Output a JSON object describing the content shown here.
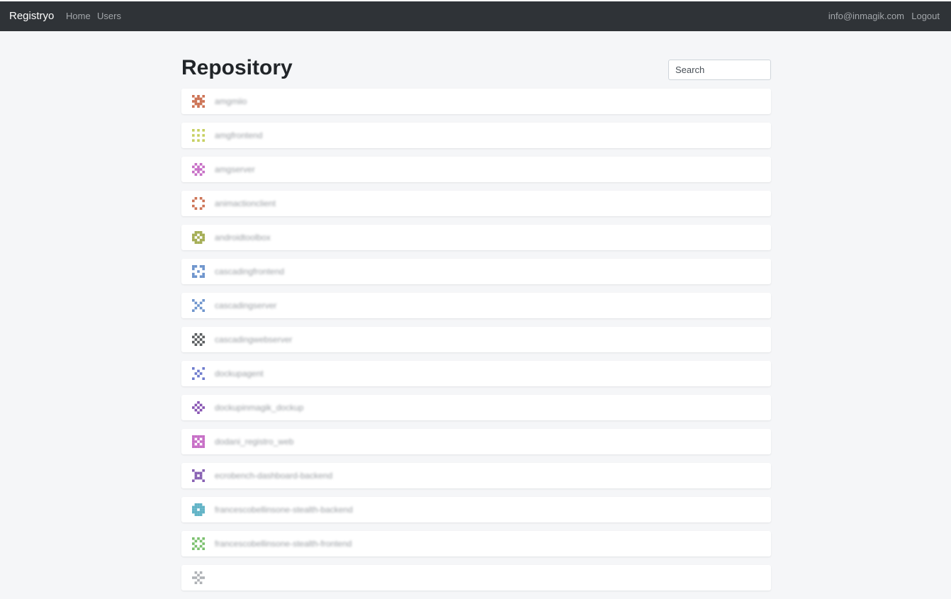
{
  "navbar": {
    "brand": "Registryo",
    "home": "Home",
    "users": "Users",
    "email": "info@inmagik.com",
    "logout": "Logout"
  },
  "page": {
    "title": "Repository",
    "search_placeholder": "Search"
  },
  "repositories": [
    {
      "name": "amgmiio",
      "icon": "identicon",
      "color": "#c0502a"
    },
    {
      "name": "amgfrontend",
      "icon": "identicon",
      "color": "#b8c43a"
    },
    {
      "name": "amgserver",
      "icon": "identicon",
      "color": "#b94bb8"
    },
    {
      "name": "animactionclient",
      "icon": "identicon",
      "color": "#c0502a"
    },
    {
      "name": "androidtoolbox",
      "icon": "identicon",
      "color": "#8f9a2a"
    },
    {
      "name": "cascadingfrontend",
      "icon": "identicon",
      "color": "#4a7ac0"
    },
    {
      "name": "cascadingserver",
      "icon": "identicon",
      "color": "#4a7ac0"
    },
    {
      "name": "cascadingwebserver",
      "icon": "identicon",
      "color": "#2f3337"
    },
    {
      "name": "dockupagent",
      "icon": "identicon",
      "color": "#4a5ac0"
    },
    {
      "name": "dockupinmagik_dockup",
      "icon": "identicon",
      "color": "#6a2aa0"
    },
    {
      "name": "dodani_registro_web",
      "icon": "identicon",
      "color": "#b94bb8"
    },
    {
      "name": "ecrobench-dashboard-backend",
      "icon": "identicon",
      "color": "#6a3aa0"
    },
    {
      "name": "francescobellinsone-stealth-backend",
      "icon": "identicon",
      "color": "#3aa0b8"
    },
    {
      "name": "francescobellinsone-stealth-frontend",
      "icon": "identicon",
      "color": "#5ab04a"
    },
    {
      "name": "",
      "icon": "identicon",
      "color": "#9a9ea3"
    }
  ]
}
